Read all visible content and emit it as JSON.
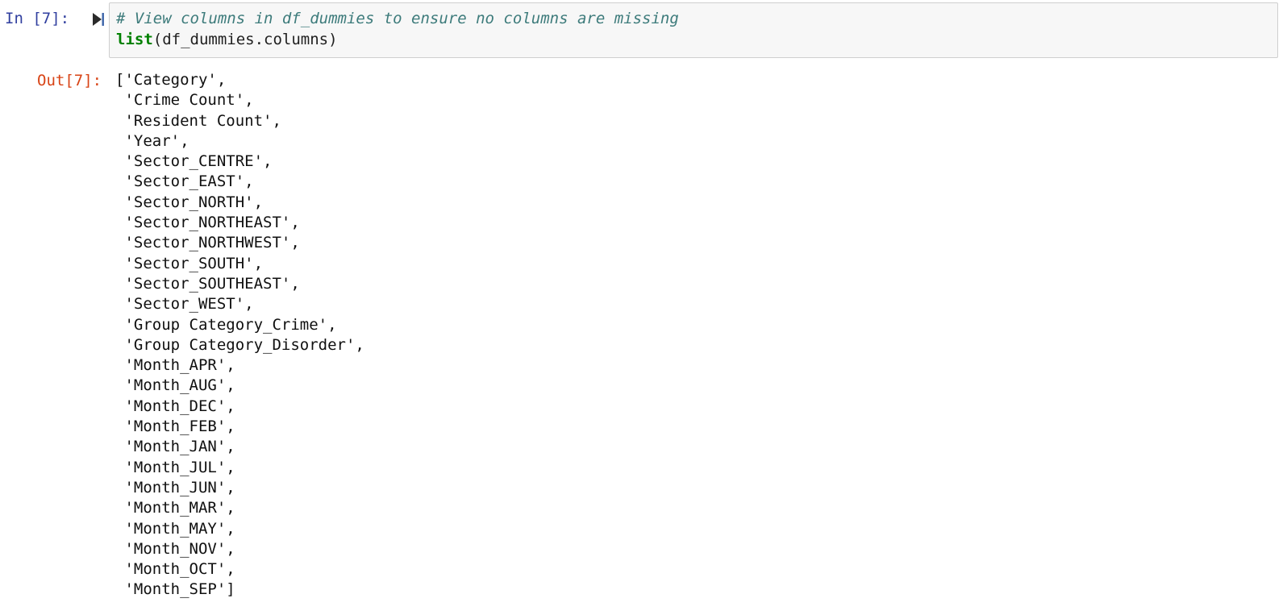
{
  "cell": {
    "input_prompt": "In [7]:",
    "output_prompt": "Out[7]:",
    "execution_count": 7,
    "run_icon": "step-forward-icon",
    "code": {
      "comment_line": "# View columns in df_dummies to ensure no columns are missing",
      "call_builtin": "list",
      "call_args": "(df_dummies.columns)",
      "full_line_2": "list(df_dummies.columns)"
    },
    "output_text": "['Category',\n 'Crime Count',\n 'Resident Count',\n 'Year',\n 'Sector_CENTRE',\n 'Sector_EAST',\n 'Sector_NORTH',\n 'Sector_NORTHEAST',\n 'Sector_NORTHWEST',\n 'Sector_SOUTH',\n 'Sector_SOUTHEAST',\n 'Sector_WEST',\n 'Group Category_Crime',\n 'Group Category_Disorder',\n 'Month_APR',\n 'Month_AUG',\n 'Month_DEC',\n 'Month_FEB',\n 'Month_JAN',\n 'Month_JUL',\n 'Month_JUN',\n 'Month_MAR',\n 'Month_MAY',\n 'Month_NOV',\n 'Month_OCT',\n 'Month_SEP']",
    "output_items": [
      "Category",
      "Crime Count",
      "Resident Count",
      "Year",
      "Sector_CENTRE",
      "Sector_EAST",
      "Sector_NORTH",
      "Sector_NORTHEAST",
      "Sector_NORTHWEST",
      "Sector_SOUTH",
      "Sector_SOUTHEAST",
      "Sector_WEST",
      "Group Category_Crime",
      "Group Category_Disorder",
      "Month_APR",
      "Month_AUG",
      "Month_DEC",
      "Month_FEB",
      "Month_JAN",
      "Month_JUL",
      "Month_JUN",
      "Month_MAR",
      "Month_MAY",
      "Month_NOV",
      "Month_OCT",
      "Month_SEP"
    ]
  },
  "colors": {
    "in_prompt": "#303F9F",
    "out_prompt": "#D84315",
    "comment": "#3D7B7B",
    "builtin": "#008000",
    "code_text": "#1f1f1f",
    "cell_background": "#f7f7f7",
    "cell_border": "#cfcfcf",
    "page_background": "#ffffff"
  }
}
